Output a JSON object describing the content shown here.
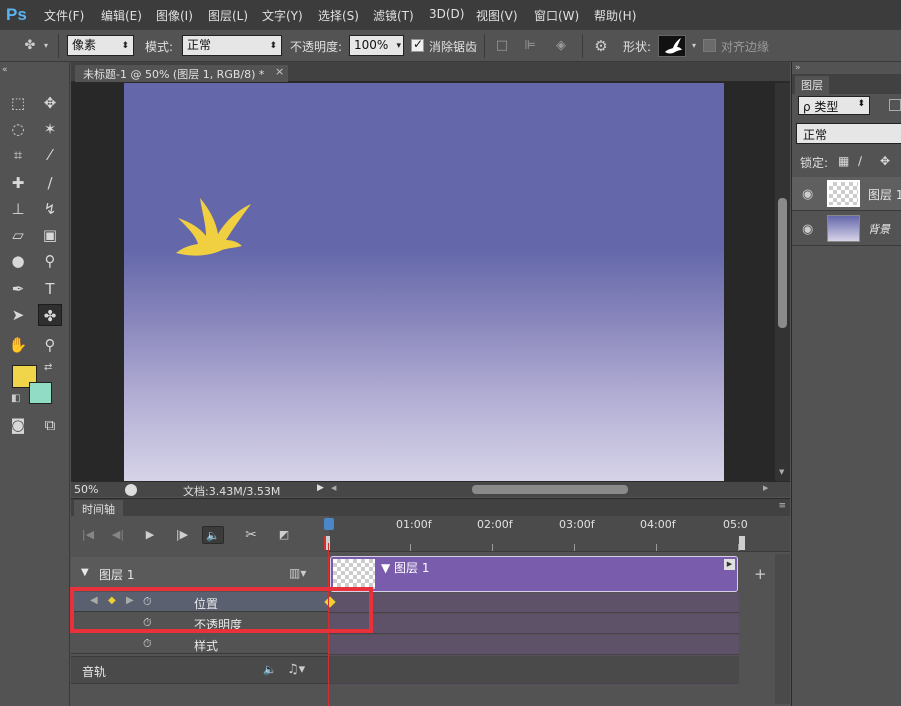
{
  "app": {
    "logo": "Ps",
    "menu": [
      "文件(F)",
      "编辑(E)",
      "图像(I)",
      "图层(L)",
      "文字(Y)",
      "选择(S)",
      "滤镜(T)",
      "3D(D)",
      "视图(V)",
      "窗口(W)",
      "帮助(H)"
    ]
  },
  "options_bar": {
    "tool_mode": "像素",
    "mode_label": "模式:",
    "mode_value": "正常",
    "opacity_label": "不透明度:",
    "opacity_value": "100%",
    "antialias_label": "消除锯齿",
    "antialias_checked": true,
    "shape_label": "形状:",
    "align_edges_label": "对齐边缘",
    "align_edges_checked": false
  },
  "toolbar": {
    "collapse": "«",
    "foreground_color": "#f0d44a",
    "background_color": "#90dcc4"
  },
  "document": {
    "tab_title": "未标题-1 @ 50% (图层 1, RGB/8) *",
    "close": "×",
    "zoom": "50%",
    "doc_info": "文档:3.43M/3.53M",
    "canvas_top_color": "#6467aa",
    "canvas_bottom_color": "#d6d3e8",
    "dove_color": "#f0d040"
  },
  "timeline": {
    "tab_label": "时间轴",
    "ruler_labels": [
      "01:00f",
      "02:00f",
      "03:00f",
      "04:00f",
      "05:0"
    ],
    "layer_name": "图层 1",
    "clip_label": "图层 1",
    "properties": {
      "position": "位置",
      "opacity": "不透明度",
      "style": "样式"
    },
    "audio_track": "音轨",
    "add_track": "+"
  },
  "layers_panel": {
    "tab_label": "图层",
    "filter_label": "ρ 类型",
    "blend_mode": "正常",
    "lock_label": "锁定:",
    "layers": [
      {
        "name": "图层 1",
        "selected": true
      },
      {
        "name": "背景",
        "selected": false
      }
    ]
  },
  "annotation": {
    "highlight_color": "#e8313a"
  }
}
